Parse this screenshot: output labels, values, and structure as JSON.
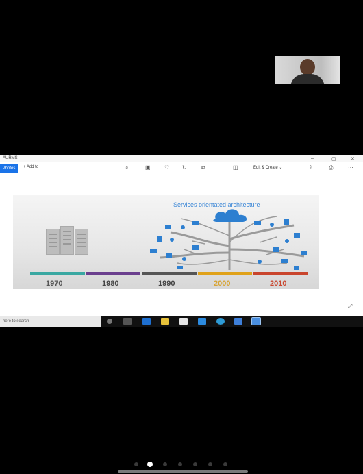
{
  "webcam": {
    "icon": "person-video-icon"
  },
  "app": {
    "title": "AURMS",
    "window_controls": [
      "–",
      "▢",
      "✕"
    ],
    "toolbar": {
      "photos_label": "Photos",
      "add_to_label": "Add to",
      "edit_create_label": "Edit & Create"
    }
  },
  "slide": {
    "title": "Services orientated architecture",
    "timeline": [
      {
        "year": "1970",
        "color": "#3aa8a2",
        "text_color": "#555"
      },
      {
        "year": "1980",
        "color": "#6b3f8e",
        "text_color": "#444"
      },
      {
        "year": "1990",
        "color": "#555555",
        "text_color": "#444"
      },
      {
        "year": "2000",
        "color": "#e0a21a",
        "text_color": "#d8a434"
      },
      {
        "year": "2010",
        "color": "#c9452d",
        "text_color": "#c9452d"
      }
    ]
  },
  "taskbar": {
    "search_placeholder": "here to search"
  }
}
